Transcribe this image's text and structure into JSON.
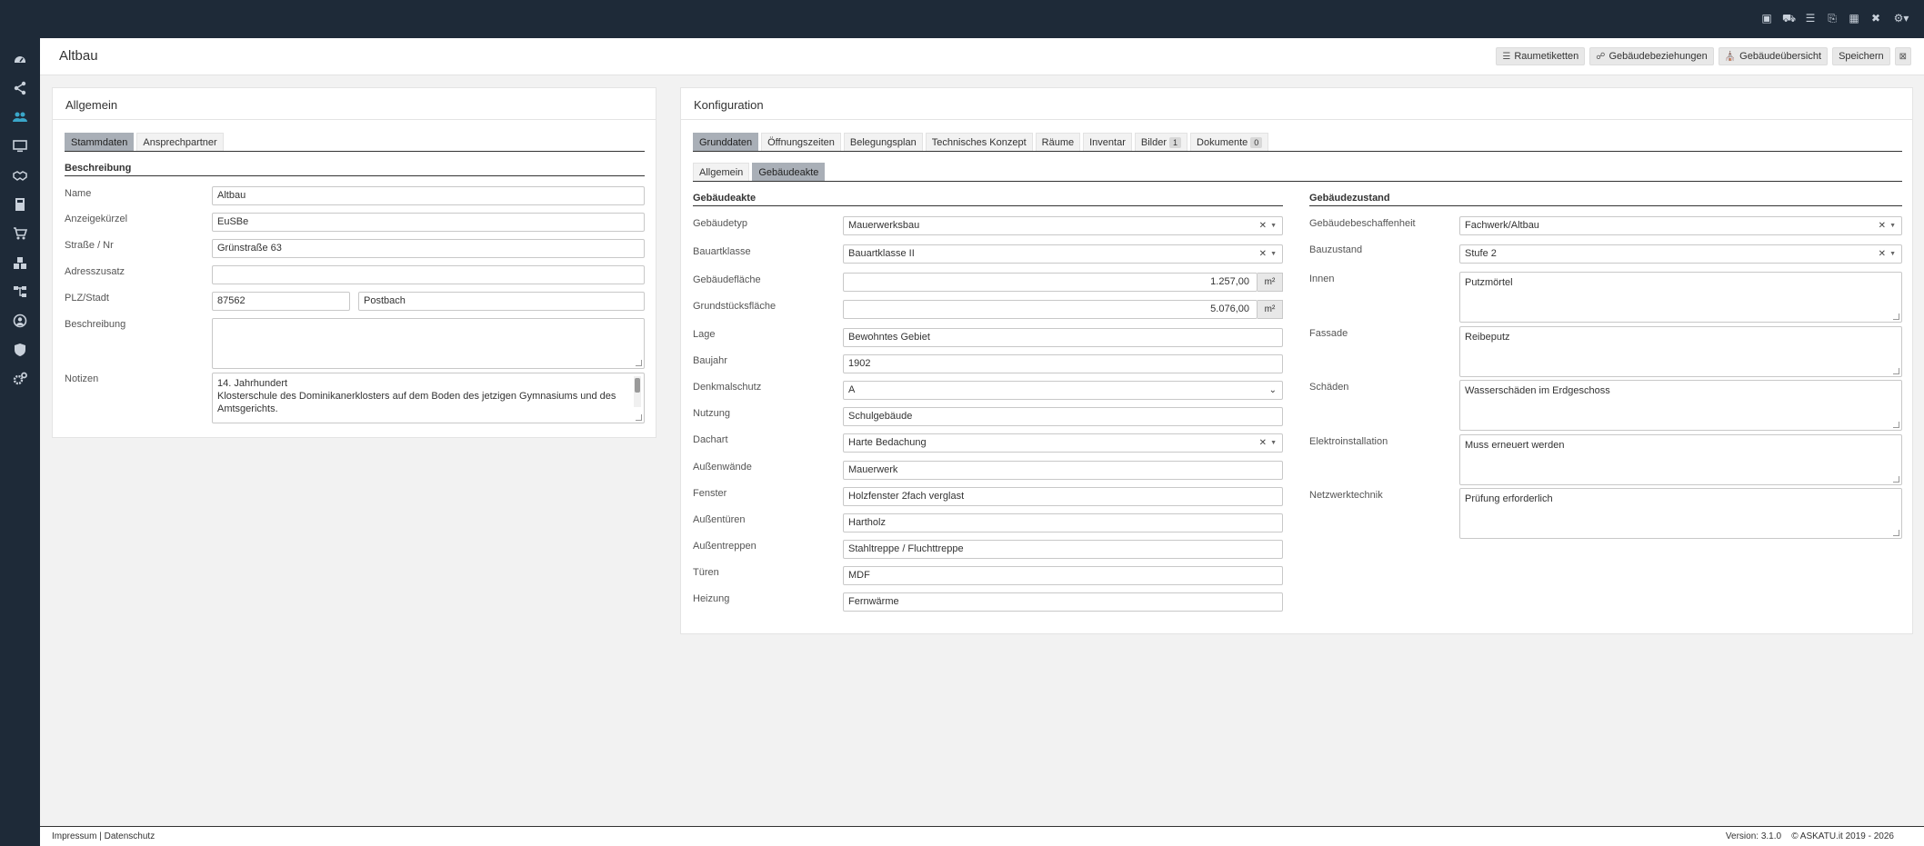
{
  "page": {
    "title": "Altbau"
  },
  "header_actions": [
    {
      "label": "Raumetiketten",
      "icon": "list-icon"
    },
    {
      "label": "Gebäudebeziehungen",
      "icon": "share-icon"
    },
    {
      "label": "Gebäudeübersicht",
      "icon": "buildings-icon"
    },
    {
      "label": "Speichern"
    }
  ],
  "left_panel": {
    "title": "Allgemein",
    "tabs": [
      "Stammdaten",
      "Ansprechpartner"
    ],
    "section": "Beschreibung",
    "labels": {
      "name": "Name",
      "short": "Anzeigekürzel",
      "street": "Straße / Nr",
      "addr2": "Adresszusatz",
      "zipcity": "PLZ/Stadt",
      "desc": "Beschreibung",
      "notes": "Notizen"
    },
    "values": {
      "name": "Altbau",
      "short": "EuSBe",
      "street": "Grünstraße 63",
      "addr2": "",
      "zip": "87562",
      "city": "Postbach",
      "desc": "",
      "notes_line1": "14. Jahrhundert",
      "notes_line2": "Klosterschule des Dominikanerklosters auf dem Boden des jetzigen Gymnasiums und des Amtsgerichts."
    }
  },
  "right_panel": {
    "title": "Konfiguration",
    "tabs": [
      {
        "label": "Grunddaten"
      },
      {
        "label": "Öffnungszeiten"
      },
      {
        "label": "Belegungsplan"
      },
      {
        "label": "Technisches Konzept"
      },
      {
        "label": "Räume"
      },
      {
        "label": "Inventar"
      },
      {
        "label": "Bilder",
        "badge": "1"
      },
      {
        "label": "Dokumente",
        "badge": "0"
      }
    ],
    "subtabs": [
      "Allgemein",
      "Gebäudeakte"
    ],
    "akte": {
      "title": "Gebäudeakte",
      "unit": "m²",
      "labels": {
        "typ": "Gebäudetyp",
        "klasse": "Bauartklasse",
        "flaeche": "Gebäudefläche",
        "grund": "Grundstücksfläche",
        "lage": "Lage",
        "baujahr": "Baujahr",
        "denkmal": "Denkmalschutz",
        "nutzung": "Nutzung",
        "dachart": "Dachart",
        "waende": "Außenwände",
        "fenster": "Fenster",
        "tueren_a": "Außentüren",
        "treppen": "Außentreppen",
        "tueren": "Türen",
        "heizung": "Heizung"
      },
      "values": {
        "typ": "Mauerwerksbau",
        "klasse": "Bauartklasse II",
        "flaeche": "1.257,00",
        "grund": "5.076,00",
        "lage": "Bewohntes Gebiet",
        "baujahr": "1902",
        "denkmal": "A",
        "nutzung": "Schulgebäude",
        "dachart": "Harte Bedachung",
        "waende": "Mauerwerk",
        "fenster": "Holzfenster 2fach verglast",
        "tueren_a": "Hartholz",
        "treppen": "Stahltreppe / Fluchttreppe",
        "tueren": "MDF",
        "heizung": "Fernwärme"
      }
    },
    "zustand": {
      "title": "Gebäudezustand",
      "labels": {
        "beschaffenheit": "Gebäudebeschaffenheit",
        "bauzustand": "Bauzustand",
        "innen": "Innen",
        "fassade": "Fassade",
        "schaeden": "Schäden",
        "elektro": "Elektroinstallation",
        "netzwerk": "Netzwerktechnik"
      },
      "values": {
        "beschaffenheit": "Fachwerk/Altbau",
        "bauzustand": "Stufe 2",
        "innen": "Putzmörtel",
        "fassade": "Reibeputz",
        "schaeden": "Wasserschäden im Erdgeschoss",
        "elektro": "Muss erneuert werden",
        "netzwerk": "Prüfung erforderlich"
      }
    }
  },
  "footer": {
    "links": "Impressum | Datenschutz",
    "version": "Version: 3.1.0",
    "copyright": "© ASKATU.it 2019 - 2026"
  },
  "colors": {
    "sidebar": "#1e2a38",
    "active_sidebar_icon": "#3aa6c9",
    "active_tab": "#a9afb7"
  }
}
